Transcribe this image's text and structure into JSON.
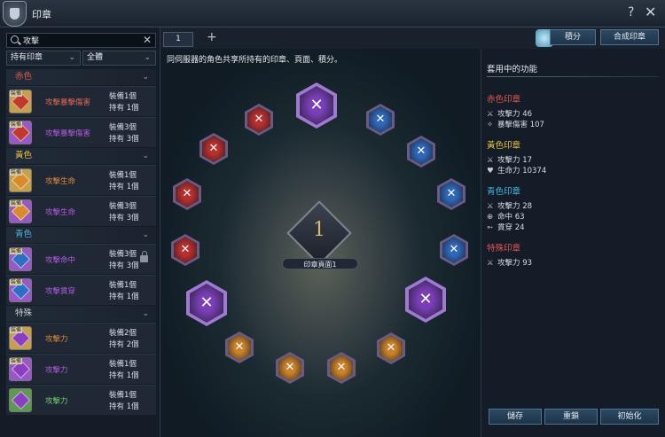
{
  "window": {
    "title": "印章"
  },
  "search": {
    "value": "攻擊"
  },
  "filters": {
    "ownership": "持有印章",
    "scope": "全體"
  },
  "categories": [
    {
      "label": "赤色",
      "color": "#e0574f",
      "items": [
        {
          "name": "攻擊暴擊傷害",
          "name_color": "#e06a58",
          "equipped": "裝備1個",
          "owned": "持有 1個",
          "gem_color": "#c0392b",
          "frame": "#c9a04a",
          "tag": "裝備",
          "locked": false
        },
        {
          "name": "攻擊暴擊傷害",
          "name_color": "#b35be0",
          "equipped": "裝備3個",
          "owned": "持有 3個",
          "gem_color": "#c0392b",
          "frame": "#9a57c9",
          "tag": "裝備",
          "locked": false
        }
      ]
    },
    {
      "label": "黃色",
      "color": "#e8c24a",
      "items": [
        {
          "name": "攻擊生命",
          "name_color": "#e08a3a",
          "equipped": "裝備1個",
          "owned": "持有 1個",
          "gem_color": "#d98a2b",
          "frame": "#c9a04a",
          "tag": "裝備",
          "locked": false
        },
        {
          "name": "攻擊生命",
          "name_color": "#b35be0",
          "equipped": "裝備3個",
          "owned": "持有 3個",
          "gem_color": "#d98a2b",
          "frame": "#9a57c9",
          "tag": "裝備",
          "locked": false
        }
      ]
    },
    {
      "label": "青色",
      "color": "#49b8e8",
      "items": [
        {
          "name": "攻擊命中",
          "name_color": "#b35be0",
          "equipped": "裝備3個",
          "owned": "持有 3個",
          "gem_color": "#2d6fc2",
          "frame": "#9a57c9",
          "tag": "裝備",
          "locked": true
        },
        {
          "name": "攻擊貫穿",
          "name_color": "#b35be0",
          "equipped": "裝備1個",
          "owned": "持有 1個",
          "gem_color": "#2d6fc2",
          "frame": "#9a57c9",
          "tag": "裝備",
          "locked": false
        }
      ]
    },
    {
      "label": "特殊",
      "color": "#c9ccd2",
      "items": [
        {
          "name": "攻擊力",
          "name_color": "#e08a3a",
          "equipped": "裝備2個",
          "owned": "持有 2個",
          "gem_color": "#8a3fc2",
          "frame": "#c9a04a",
          "tag": "裝備",
          "locked": false
        },
        {
          "name": "攻擊力",
          "name_color": "#b35be0",
          "equipped": "裝備1個",
          "owned": "持有 1個",
          "gem_color": "#8a3fc2",
          "frame": "#9a57c9",
          "tag": "裝備",
          "locked": false
        },
        {
          "name": "攻擊力",
          "name_color": "#6fd06a",
          "equipped": "裝備1個",
          "owned": "持有 1個",
          "gem_color": "#8a3fc2",
          "frame": "#5a9c4a",
          "tag": "",
          "locked": false
        }
      ]
    }
  ],
  "tabs": {
    "page1": "1",
    "add": "+"
  },
  "top_buttons": {
    "points": "積分",
    "craft": "合成印章"
  },
  "description": "同伺服器的角色共享所持有的印章、頁面、積分。",
  "board": {
    "center_number": "1",
    "center_label": "印章頁面1",
    "slots": [
      {
        "type": "special",
        "color": "#7a3fb8",
        "ring": "#9e7ad0"
      },
      {
        "type": "blue",
        "color": "#2f68b8",
        "ring": "#6a5a84"
      },
      {
        "type": "blue",
        "color": "#2f68b8",
        "ring": "#6a5a84"
      },
      {
        "type": "blue",
        "color": "#2f68b8",
        "ring": "#6a5a84"
      },
      {
        "type": "blue",
        "color": "#2f68b8",
        "ring": "#6a5a84"
      },
      {
        "type": "special",
        "color": "#7a3fb8",
        "ring": "#9e7ad0"
      },
      {
        "type": "yellow",
        "color": "#c9822a",
        "ring": "#6a5a84"
      },
      {
        "type": "yellow",
        "color": "#c9822a",
        "ring": "#6a5a84"
      },
      {
        "type": "yellow",
        "color": "#c9822a",
        "ring": "#6a5a84"
      },
      {
        "type": "yellow",
        "color": "#c9822a",
        "ring": "#6a5a84"
      },
      {
        "type": "special",
        "color": "#7a3fb8",
        "ring": "#9e7ad0"
      },
      {
        "type": "red",
        "color": "#b8302e",
        "ring": "#6a5a84"
      },
      {
        "type": "red",
        "color": "#b8302e",
        "ring": "#6a5a84"
      },
      {
        "type": "red",
        "color": "#b8302e",
        "ring": "#6a5a84"
      },
      {
        "type": "red",
        "color": "#b8302e",
        "ring": "#6a5a84"
      }
    ]
  },
  "effects": {
    "title": "套用中的功能",
    "groups": [
      {
        "label": "赤色印章",
        "color": "#e0574f",
        "stats": [
          {
            "icon": "⚔",
            "text": "攻擊力 46"
          },
          {
            "icon": "✧",
            "text": "暴擊傷害 107"
          }
        ]
      },
      {
        "label": "黃色印章",
        "color": "#e8c24a",
        "stats": [
          {
            "icon": "⚔",
            "text": "攻擊力 17"
          },
          {
            "icon": "♥",
            "text": "生命力 10374"
          }
        ]
      },
      {
        "label": "青色印章",
        "color": "#49b8e8",
        "stats": [
          {
            "icon": "⚔",
            "text": "攻擊力 28"
          },
          {
            "icon": "⊕",
            "text": "命中 63"
          },
          {
            "icon": "➵",
            "text": "貫穿 24"
          }
        ]
      },
      {
        "label": "特殊印章",
        "color": "#e0574f",
        "stats": [
          {
            "icon": "⚔",
            "text": "攻擊力 93"
          }
        ]
      }
    ]
  },
  "bottom_buttons": {
    "save": "儲存",
    "reset": "重鎖",
    "init": "初始化"
  }
}
